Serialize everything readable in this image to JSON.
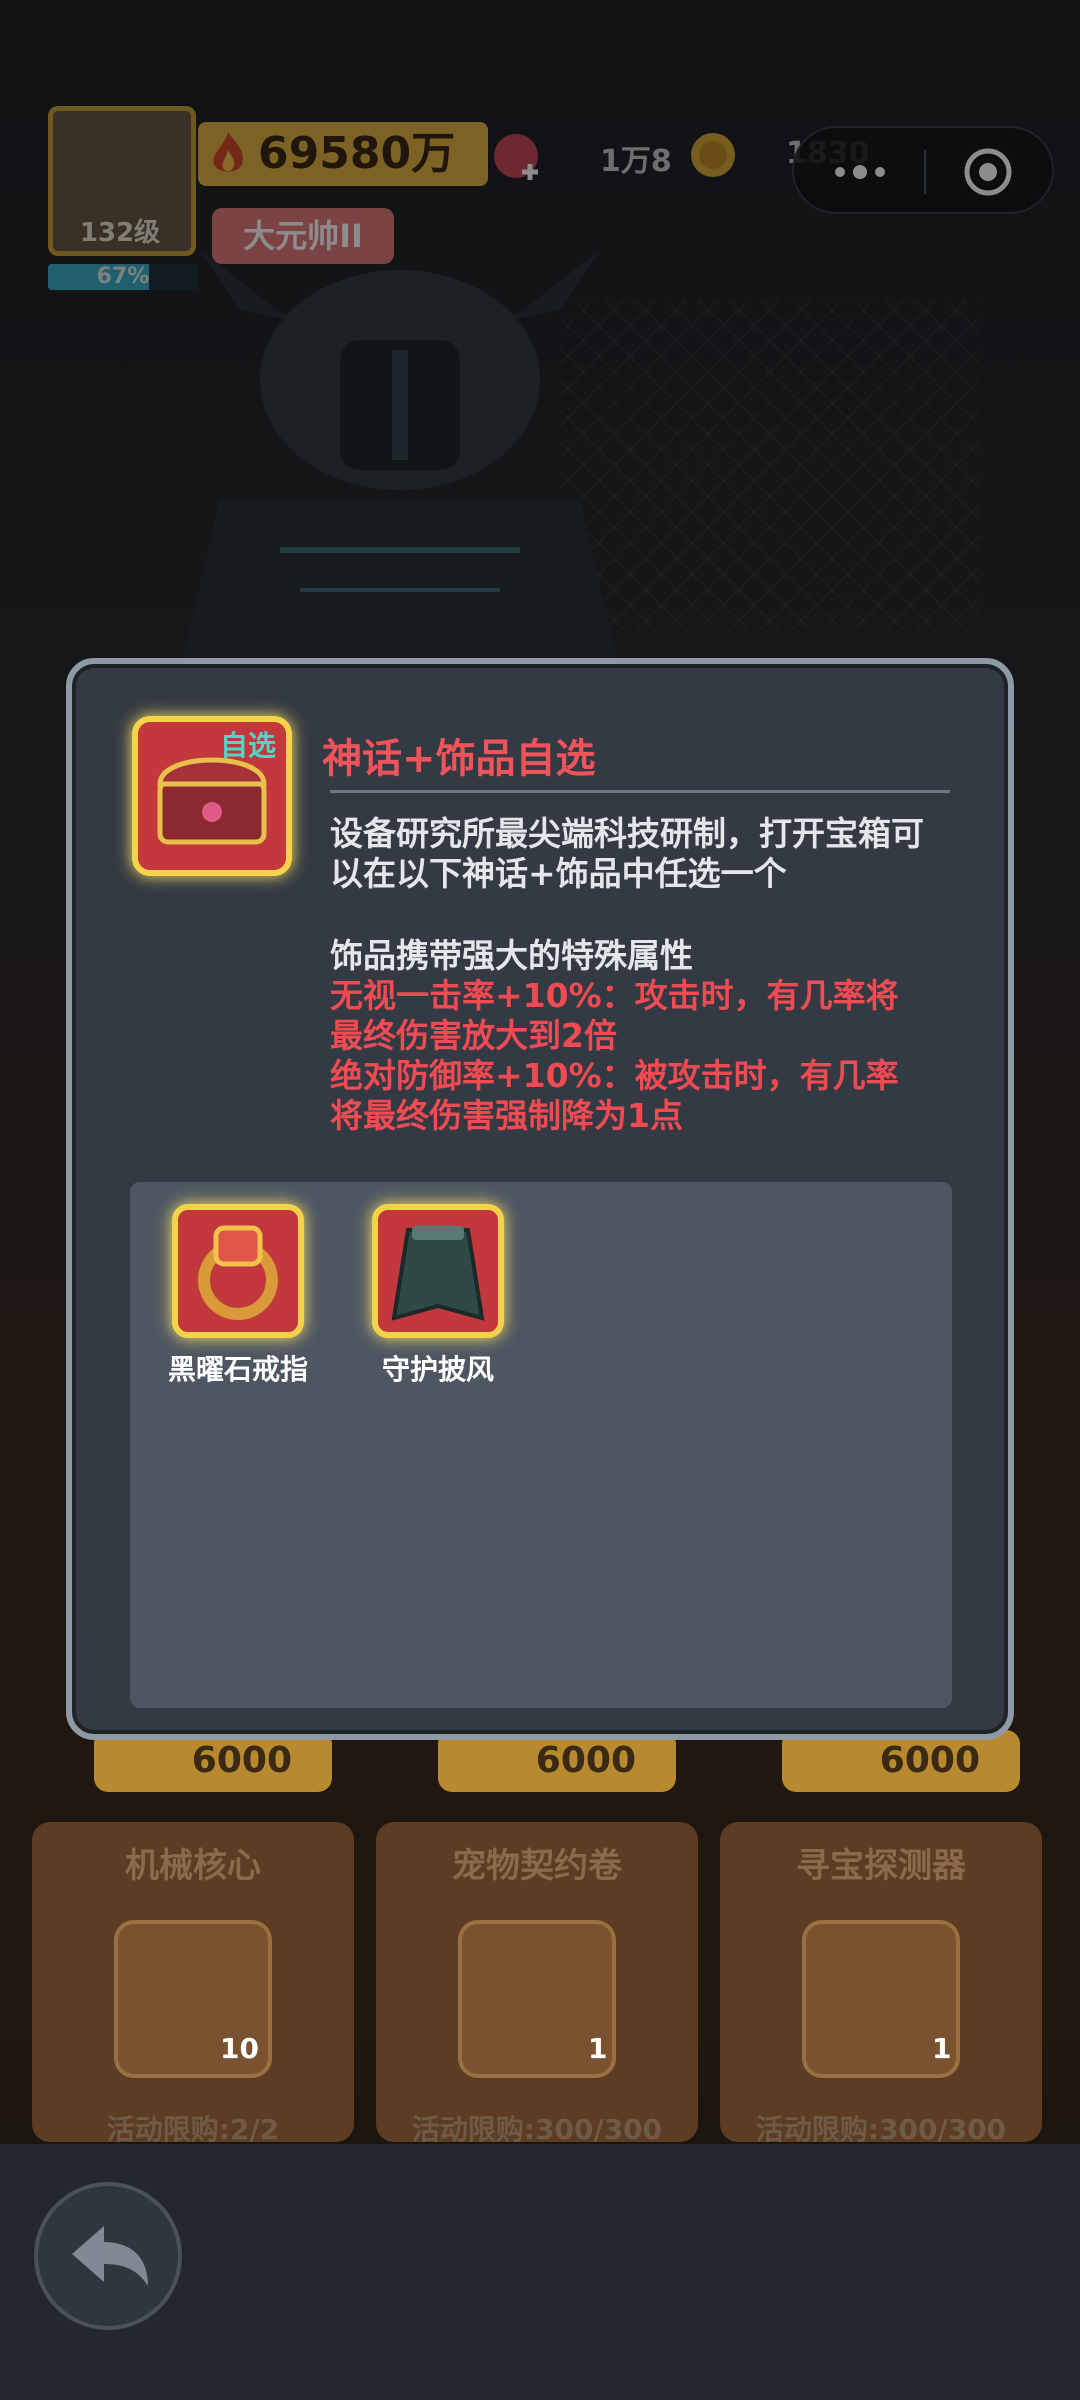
{
  "hud": {
    "level": "132级",
    "xp_percent_text": "67%",
    "xp_fraction": 0.67,
    "power": "69580万",
    "player_name": "大元帅II",
    "gems": "1万8",
    "coins": "1830"
  },
  "modal": {
    "badge": "自选",
    "title": "神话+饰品自选",
    "description": "设备研究所最尖端科技研制，打开宝箱可以在以下神话+饰品中任选一个",
    "subheading": "饰品携带强大的特殊属性",
    "attr1_line1": "无视一击率+10%：攻击时，有几率将",
    "attr1_line2": "最终伤害放大到2倍",
    "attr2_line1": "绝对防御率+10%：被攻击时，有几率",
    "attr2_line2": "将最终伤害强制降为1点",
    "items": [
      {
        "label": "黑曜石戒指",
        "icon": "ring-icon"
      },
      {
        "label": "守护披风",
        "icon": "cloak-icon"
      }
    ]
  },
  "shop": {
    "prices": [
      "6000",
      "6000",
      "6000"
    ],
    "cards": [
      {
        "title": "机械核心",
        "qty": "10",
        "limit": "活动限购:2/2"
      },
      {
        "title": "宠物契约卷",
        "qty": "1",
        "limit": "活动限购:300/300"
      },
      {
        "title": "寻宝探测器",
        "qty": "1",
        "limit": "活动限购:300/300"
      }
    ]
  },
  "colors": {
    "accent_red": "#f04a53",
    "gold": "#f4d34a",
    "panel": "#343a43"
  }
}
